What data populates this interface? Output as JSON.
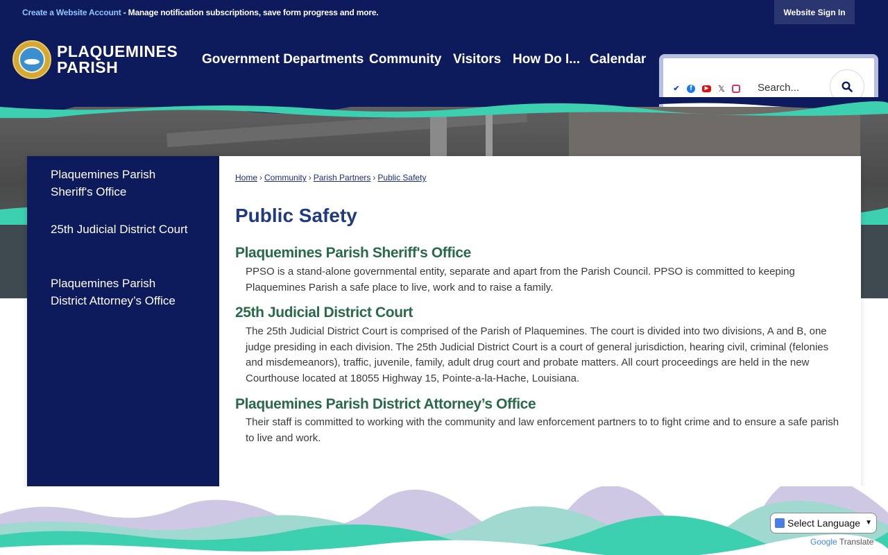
{
  "topbar": {
    "create_account": "Create a Website Account",
    "message": " - Manage notification subscriptions, save form progress and more.",
    "signin": "Website Sign In"
  },
  "header": {
    "logo_line1": "PLAQUEMINES",
    "logo_line2": "PARISH",
    "nav": [
      "Government Departments",
      "Community",
      "Visitors",
      "How Do I...",
      "Calendar"
    ],
    "search_placeholder": "Search...",
    "social_icons": [
      "checkmark-icon",
      "facebook-icon",
      "youtube-icon",
      "x-icon",
      "instagram-icon"
    ]
  },
  "sidebar": {
    "items": [
      {
        "label": "Plaquemines Parish Sheriff's Office"
      },
      {
        "label": "25th Judicial District Court"
      },
      {
        "label": "Plaquemines Parish District Attorney’s Office"
      }
    ]
  },
  "breadcrumb": [
    "Home",
    "Community",
    "Parish Partners",
    "Public Safety"
  ],
  "main": {
    "title": "Public Safety",
    "sections": [
      {
        "heading": "Plaquemines Parish Sheriff's Office",
        "text": "PPSO is a stand-alone governmental entity, separate and apart from the Parish Council. PPSO is committed to keeping Plaquemines Parish a safe place to live, work and to raise a family."
      },
      {
        "heading": "25th Judicial District Court",
        "text": "The 25th Judicial District Court is comprised of the Parish of Plaquemines. The court is divided into two divisions, A and B, one judge presiding in each division. The 25th Judicial District Court is a court of general jurisdiction, hearing civil, criminal (felonies and misdemeanors), traffic, juvenile, family, adult drug court and probate matters. All court proceedings are held in the new Courthouse located at 18055 Highway 15, Pointe-a-la-Hache, Louisiana."
      },
      {
        "heading": "Plaquemines Parish District Attorney’s Office",
        "text": "Their staff is committed to working with the community and law enforcement partners to to fight crime and to ensure a safe parish to live and work."
      }
    ]
  },
  "translate": {
    "label": "Select Language",
    "powered_google": "Google",
    "powered_text": "Translate"
  },
  "colors": {
    "navy": "#0d1a5c",
    "title_blue": "#1f3a80",
    "heading_green": "#2a6a4a",
    "wave_teal": "#3ccfb0"
  }
}
